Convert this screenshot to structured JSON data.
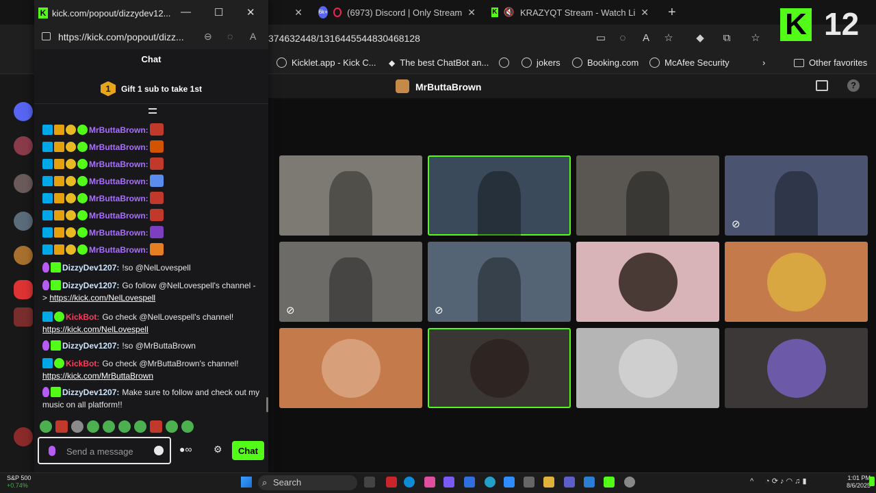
{
  "browser": {
    "tabs": [
      {
        "label": "(6973) Discord | Only Stream",
        "badge": "6k+"
      },
      {
        "label": "KRAZYQT Stream - Watch Li"
      }
    ],
    "new_tab": "+",
    "url_fragment": "374632448/1316445544830468128",
    "favorites": [
      "Kicklet.app - Kick C...",
      "The best ChatBot an...",
      "jokers",
      "Booking.com",
      "McAfee Security"
    ],
    "other_favorites": "Other favorites"
  },
  "meeting": {
    "host_name": "MrButtaBrown",
    "tiles": [
      {
        "kind": "video",
        "color": "#7c7a72",
        "speaking": false,
        "muted": false
      },
      {
        "kind": "video",
        "color": "#3b4a5a",
        "speaking": true,
        "muted": false
      },
      {
        "kind": "video",
        "color": "#5a5652",
        "speaking": false,
        "muted": false
      },
      {
        "kind": "video",
        "color": "#4a5470",
        "speaking": false,
        "muted": true
      },
      {
        "kind": "video",
        "color": "#6d6b68",
        "speaking": false,
        "muted": true
      },
      {
        "kind": "video",
        "color": "#546474",
        "speaking": false,
        "muted": true
      },
      {
        "kind": "avatar",
        "color": "#d8b4b8",
        "avatar_color": "#4a3a36",
        "speaking": false,
        "muted": false
      },
      {
        "kind": "avatar",
        "color": "#c47a4a",
        "avatar_color": "#d9a742",
        "speaking": false,
        "muted": false
      },
      {
        "kind": "avatar",
        "color": "#c47a4a",
        "avatar_color": "#d7a07a",
        "speaking": false,
        "muted": false
      },
      {
        "kind": "avatar",
        "color": "#3a3633",
        "avatar_color": "#2e2522",
        "speaking": true,
        "muted": false
      },
      {
        "kind": "avatar",
        "color": "#b5b5b5",
        "avatar_color": "#cfcfcf",
        "speaking": false,
        "muted": false
      },
      {
        "kind": "avatar",
        "color": "#3c3838",
        "avatar_color": "#6c5aa8",
        "speaking": false,
        "muted": false
      }
    ]
  },
  "popout": {
    "window_title": "kick.com/popout/dizzydev12...",
    "url": "https://kick.com/popout/dizz...",
    "chat_title": "Chat",
    "gift_badge": "1",
    "gift_text": "Gift 1 sub to take 1st",
    "messages": [
      {
        "type": "emote-only",
        "user": "MrButtaBrown:",
        "color": "#a970ff",
        "badges": [
          "mod",
          "vip",
          "sub",
          "ver"
        ],
        "emote": "#c0392b"
      },
      {
        "type": "emote-only",
        "user": "MrButtaBrown:",
        "color": "#a970ff",
        "badges": [
          "mod",
          "vip",
          "sub",
          "ver"
        ],
        "emote": "#d35400"
      },
      {
        "type": "emote-only",
        "user": "MrButtaBrown:",
        "color": "#a970ff",
        "badges": [
          "mod",
          "vip",
          "sub",
          "ver"
        ],
        "emote": "#c0392b"
      },
      {
        "type": "emote-only",
        "user": "MrButtaBrown:",
        "color": "#a970ff",
        "badges": [
          "mod",
          "vip",
          "sub",
          "ver"
        ],
        "emote": "#5b8def"
      },
      {
        "type": "emote-only",
        "user": "MrButtaBrown:",
        "color": "#a970ff",
        "badges": [
          "mod",
          "vip",
          "sub",
          "ver"
        ],
        "emote": "#c0392b"
      },
      {
        "type": "emote-only",
        "user": "MrButtaBrown:",
        "color": "#a970ff",
        "badges": [
          "mod",
          "vip",
          "sub",
          "ver"
        ],
        "emote": "#c0392b"
      },
      {
        "type": "emote-only",
        "user": "MrButtaBrown:",
        "color": "#a970ff",
        "badges": [
          "mod",
          "vip",
          "sub",
          "ver"
        ],
        "emote": "#7b3fbf"
      },
      {
        "type": "emote-only",
        "user": "MrButtaBrown:",
        "color": "#a970ff",
        "badges": [
          "mod",
          "vip",
          "sub",
          "ver"
        ],
        "emote": "#e67e22"
      },
      {
        "type": "text",
        "user": "DizzyDev1207:",
        "color": "#cfe7ff",
        "badges": [
          "mic",
          "green"
        ],
        "text": "!so @NelLovespell"
      },
      {
        "type": "text",
        "user": "DizzyDev1207:",
        "color": "#cfe7ff",
        "badges": [
          "mic",
          "green"
        ],
        "text": "Go follow @NelLovespell's channel - > ",
        "link": "https://kick.com/NelLovespell"
      },
      {
        "type": "text",
        "user": "KickBot:",
        "color": "#ff3b5c",
        "badges": [
          "mod",
          "ver"
        ],
        "text": "Go check @NelLovespell's channel! ",
        "link": "https://kick.com/NelLovespell"
      },
      {
        "type": "text",
        "user": "DizzyDev1207:",
        "color": "#cfe7ff",
        "badges": [
          "mic",
          "green"
        ],
        "text": "!so @MrButtaBrown"
      },
      {
        "type": "text",
        "user": "KickBot:",
        "color": "#ff3b5c",
        "badges": [
          "mod",
          "ver"
        ],
        "text": "Go check @MrButtaBrown's channel! ",
        "link": "https://kick.com/MrButtaBrown"
      },
      {
        "type": "text",
        "user": "DizzyDev1207:",
        "color": "#cfe7ff",
        "badges": [
          "mic",
          "green"
        ],
        "text": "Make sure to follow and check out my music on all platform!!"
      }
    ],
    "composer_placeholder": "Send a message",
    "send_label": "Chat"
  },
  "overlay": {
    "logo": "K",
    "number": "12"
  },
  "taskbar": {
    "stock_name": "S&P 500",
    "stock_change": "+0.74%",
    "search_label": "Search",
    "time": "1:01 PM",
    "date": "8/6/2025"
  }
}
